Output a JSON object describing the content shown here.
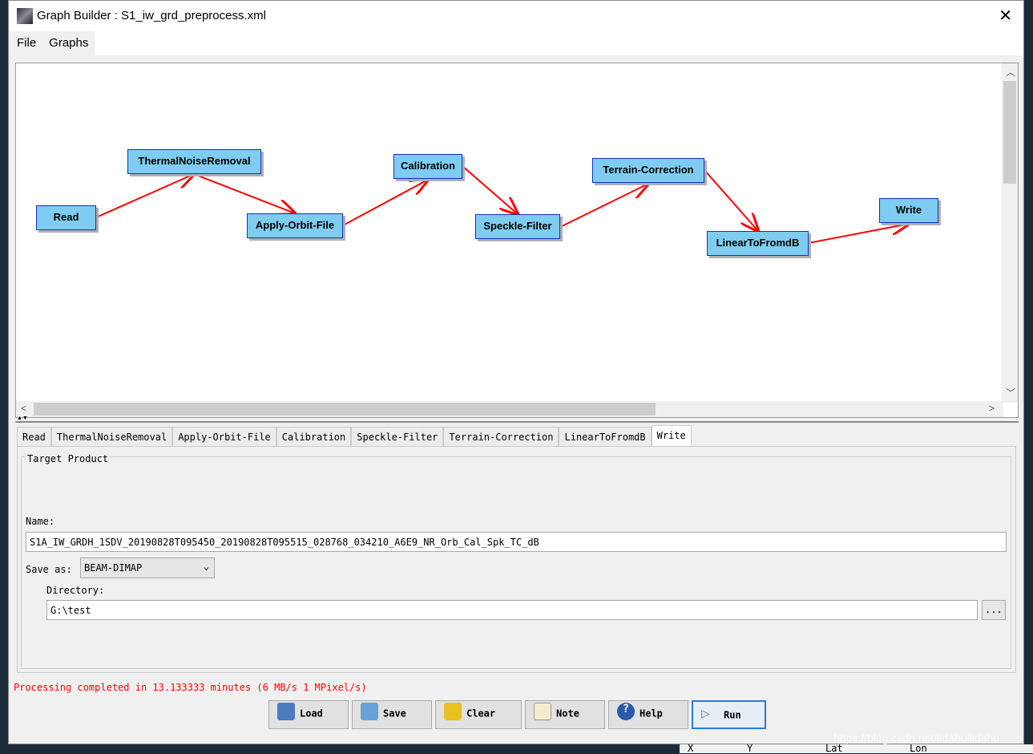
{
  "window": {
    "title": "Graph Builder : S1_iw_grd_preprocess.xml"
  },
  "menu": [
    "File",
    "Graphs"
  ],
  "graph": {
    "nodes": [
      "Read",
      "ThermalNoiseRemoval",
      "Apply-Orbit-File",
      "Calibration",
      "Speckle-Filter",
      "Terrain-Correction",
      "LinearToFromdB",
      "Write"
    ],
    "edge_color": "#ff0000",
    "node_color": "#7ecdf0"
  },
  "tabs": [
    "Read",
    "ThermalNoiseRemoval",
    "Apply-Orbit-File",
    "Calibration",
    "Speckle-Filter",
    "Terrain-Correction",
    "LinearToFromdB",
    "Write"
  ],
  "selected_tab": "Write",
  "write": {
    "group_title": "Target Product",
    "name_label": "Name:",
    "name_value": "S1A_IW_GRDH_1SDV_20190828T095450_20190828T095515_028768_034210_A6E9_NR_Orb_Cal_Spk_TC_dB",
    "save_as_label": "Save as:",
    "save_as_value": "BEAM-DIMAP",
    "directory_label": "Directory:",
    "directory_value": "G:\\test",
    "browse_label": "..."
  },
  "status": "Processing completed in 13.133333 minutes (6 MB/s 1 MPixel/s)",
  "buttons": {
    "load": "Load",
    "save": "Save",
    "clear": "Clear",
    "note": "Note",
    "help": "Help",
    "run": "Run"
  },
  "watermark": "https://blog.csdn.net/lidahuilidahu",
  "background_strip": [
    "X",
    "Y",
    "Lat",
    "Lon"
  ]
}
